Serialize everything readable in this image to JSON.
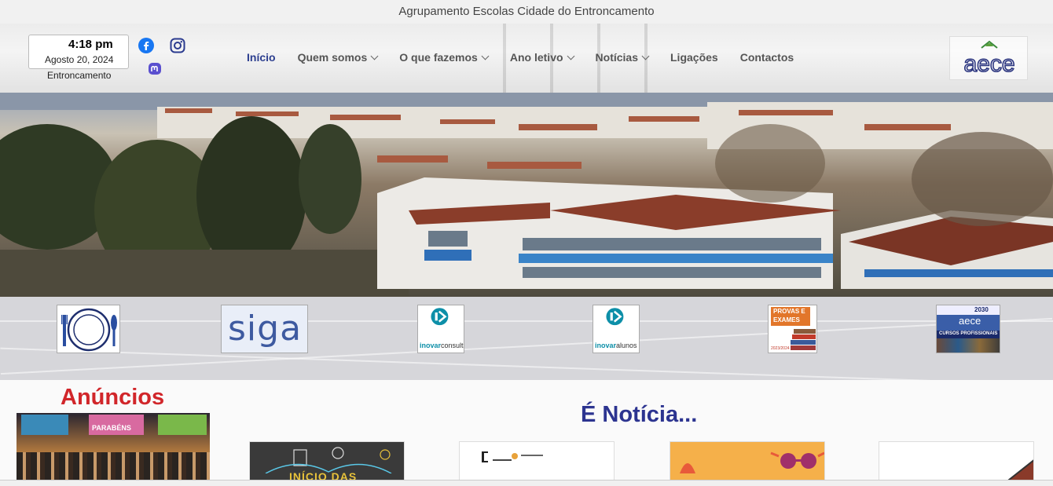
{
  "topbar": {
    "title": "Agrupamento Escolas Cidade do Entroncamento"
  },
  "header": {
    "clock": {
      "time": "4:18 pm",
      "date": "Agosto 20, 2024",
      "city": "Entroncamento"
    },
    "social": [
      {
        "name": "facebook-icon",
        "color": "#1877f2"
      },
      {
        "name": "instagram-icon",
        "color": "#2b3b8f"
      },
      {
        "name": "mastodon-icon",
        "color": "#5a4fcf"
      }
    ],
    "nav": [
      {
        "label": "Início",
        "dropdown": false,
        "active": true
      },
      {
        "label": "Quem somos",
        "dropdown": true,
        "active": false
      },
      {
        "label": "O que fazemos",
        "dropdown": true,
        "active": false
      },
      {
        "label": "Ano letivo",
        "dropdown": true,
        "active": false
      },
      {
        "label": "Notícias",
        "dropdown": true,
        "active": false
      },
      {
        "label": "Ligações",
        "dropdown": false,
        "active": false
      },
      {
        "label": "Contactos",
        "dropdown": false,
        "active": false
      }
    ],
    "logo_text": "aece"
  },
  "quick_links": [
    {
      "name": "ementas-link",
      "icon": "plate-cutlery-icon"
    },
    {
      "name": "siga-link",
      "text": "siga"
    },
    {
      "name": "inovar-consulta-link",
      "text_a": "inovar",
      "text_b": "consulta"
    },
    {
      "name": "inovar-alunos-link",
      "text_a": "inovar",
      "text_b": "alunos"
    },
    {
      "name": "provas-exames-link",
      "text_a": "PROVAS E",
      "text_b": "EXAMES",
      "text_c": "2023/2024"
    },
    {
      "name": "cursos-profissionais-link",
      "text_a": "2030",
      "text_b": "aece",
      "text_c": "CURSOS PROFISSIONAIS"
    }
  ],
  "content": {
    "anuncios_title": "Anúncios",
    "anuncio_banner": "PARABÉNS",
    "noticia_title": "É Notícia...",
    "news_cards": [
      {
        "name": "news-card-1",
        "text": "INÍCIO DAS"
      },
      {
        "name": "news-card-2"
      },
      {
        "name": "news-card-3"
      },
      {
        "name": "news-card-4"
      }
    ]
  },
  "colors": {
    "accent": "#2c3e8f",
    "anuncios": "#d1262a",
    "noticia": "#2c3490",
    "inovar": "#0d8fa8"
  }
}
